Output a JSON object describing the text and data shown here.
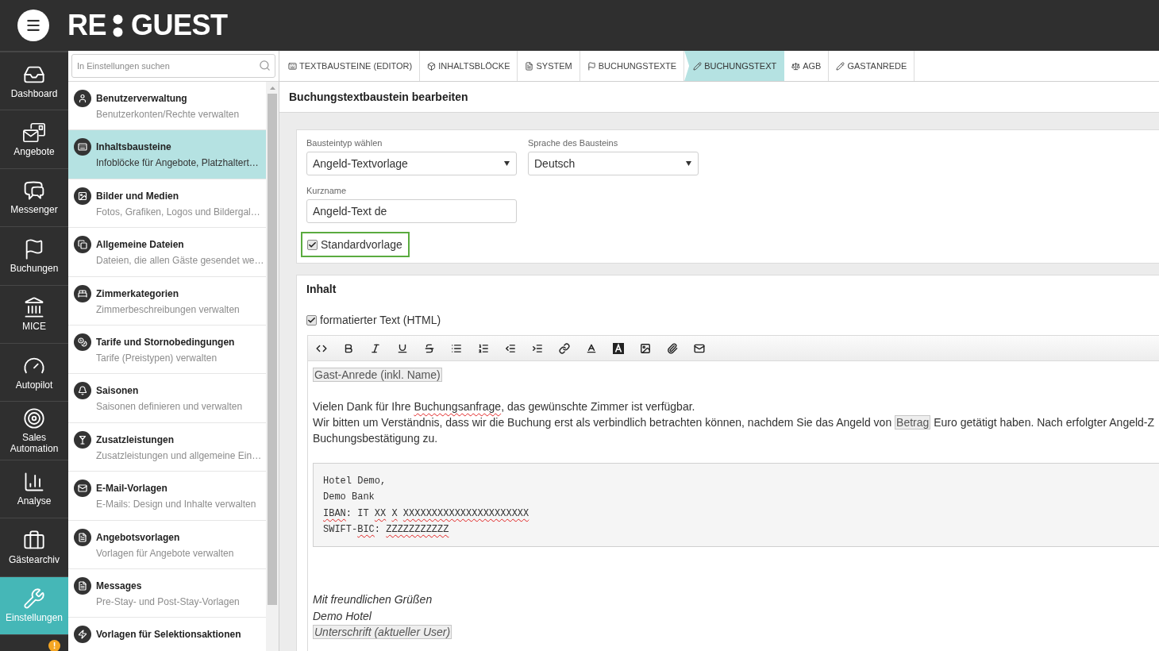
{
  "header": {
    "logo_left": "RE",
    "logo_right": "GUEST"
  },
  "nav": [
    {
      "label": "Dashboard",
      "selected": false
    },
    {
      "label": "Angebote",
      "selected": false
    },
    {
      "label": "Messenger",
      "selected": false
    },
    {
      "label": "Buchungen",
      "selected": false
    },
    {
      "label": "MICE",
      "selected": false
    },
    {
      "label": "Autopilot",
      "selected": false
    },
    {
      "label": "Sales Automation",
      "selected": false
    },
    {
      "label": "Analyse",
      "selected": false
    },
    {
      "label": "Gästearchiv",
      "selected": false
    },
    {
      "label": "Einstellungen",
      "selected": true
    },
    {
      "badge": "!",
      "selected": false
    }
  ],
  "settings": {
    "search": {
      "placeholder": "In Einstellungen suchen"
    },
    "items": [
      {
        "title": "Benutzerverwaltung",
        "subtitle": "Benutzerkonten/Rechte verwalten",
        "selected": false
      },
      {
        "title": "Inhaltsbausteine",
        "subtitle": "Infoblöcke für Angebote, Platzhaltert…",
        "selected": true
      },
      {
        "title": "Bilder und Medien",
        "subtitle": "Fotos, Grafiken, Logos und Bildergal…",
        "selected": false
      },
      {
        "title": "Allgemeine Dateien",
        "subtitle": "Dateien, die allen Gäste gesendet we…",
        "selected": false
      },
      {
        "title": "Zimmerkategorien",
        "subtitle": "Zimmerbeschreibungen verwalten",
        "selected": false
      },
      {
        "title": "Tarife und Stornobedingungen",
        "subtitle": "Tarife (Preistypen) verwalten",
        "selected": false
      },
      {
        "title": "Saisonen",
        "subtitle": "Saisonen definieren und verwalten",
        "selected": false
      },
      {
        "title": "Zusatzleistungen",
        "subtitle": "Zusatzleistungen und allgemeine Ein…",
        "selected": false
      },
      {
        "title": "E-Mail-Vorlagen",
        "subtitle": "E-Mails: Design und Inhalte verwalten",
        "selected": false
      },
      {
        "title": "Angebotsvorlagen",
        "subtitle": "Vorlagen für Angebote verwalten",
        "selected": false
      },
      {
        "title": "Messages",
        "subtitle": "Pre-Stay- und Post-Stay-Vorlagen",
        "selected": false
      },
      {
        "title": "Vorlagen für Selektionsaktionen",
        "selected": false
      }
    ]
  },
  "tabs": [
    {
      "label": "TEXTBAUSTEINE (EDITOR)",
      "selected": false
    },
    {
      "label": "INHALTSBLÖCKE",
      "selected": false
    },
    {
      "label": "SYSTEM",
      "selected": false
    },
    {
      "label": "BUCHUNGSTEXTE",
      "selected": false
    },
    {
      "label": "BUCHUNGSTEXT",
      "selected": true
    },
    {
      "label": "AGB",
      "selected": false
    },
    {
      "label": "GASTANREDE",
      "selected": false
    }
  ],
  "page_title": "Buchungstextbaustein bearbeiten",
  "form": {
    "type_select": {
      "label": "Bausteintyp wählen",
      "value": "Angeld-Textvorlage"
    },
    "language_select": {
      "label": "Sprache des Bausteins",
      "value": "Deutsch"
    },
    "short_name": {
      "label": "Kurzname",
      "value": "Angeld-Text de"
    },
    "default_template": {
      "label": "Standardvorlage",
      "checked": true,
      "focused": true
    }
  },
  "content": {
    "title": "Inhalt",
    "html_mode": {
      "label": "formatierter Text (HTML)",
      "checked": true
    },
    "blocks": [
      {
        "kind": "paragraph",
        "lines": [
          [
            {
              "kind": "placeholder",
              "text": "Gast-Anrede (inkl. Name)"
            }
          ]
        ]
      },
      {
        "kind": "paragraph",
        "lines": [
          [
            {
              "kind": "plain",
              "text": "Vielen Dank für Ihre "
            },
            {
              "kind": "misspelled",
              "text": "Buchungsanfrage"
            },
            {
              "kind": "plain",
              "text": ", das gewünschte Zimmer ist verfügbar."
            }
          ],
          [
            {
              "kind": "plain",
              "text": "Wir bitten um Verständnis, dass wir die Buchung erst als verbindlich betrachten können, nachdem Sie das Angeld von "
            },
            {
              "kind": "placeholder",
              "text": "Betrag"
            },
            {
              "kind": "plain",
              "text": " Euro getätigt haben. Nach erfolgter Angeld-Z"
            }
          ],
          [
            {
              "kind": "plain",
              "text": "Buchungsbestätigung zu."
            }
          ]
        ]
      },
      {
        "kind": "code",
        "lines": [
          [
            {
              "kind": "plain",
              "text": "Hotel Demo,"
            }
          ],
          [
            {
              "kind": "plain",
              "text": "Demo Bank"
            }
          ],
          [
            {
              "kind": "misspelled",
              "text": "IBAN"
            },
            {
              "kind": "plain",
              "text": ": IT "
            },
            {
              "kind": "misspelled",
              "text": "XX "
            },
            {
              "kind": "misspelled",
              "text": "X "
            },
            {
              "kind": "misspelled",
              "text": "XXXXXXXXXXXXXXXXXXXXXX"
            }
          ],
          [
            {
              "kind": "plain",
              "text": "SWIFT-"
            },
            {
              "kind": "misspelled",
              "text": "BIC"
            },
            {
              "kind": "plain",
              "text": ": "
            },
            {
              "kind": "misspelled",
              "text": "ZZZZZZZZZZZ"
            }
          ]
        ]
      },
      {
        "kind": "closing",
        "lines": [
          [
            {
              "kind": "plain",
              "text": "Mit freundlichen Grüßen"
            }
          ],
          [
            {
              "kind": "plain",
              "text": "Demo Hotel"
            }
          ],
          [
            {
              "kind": "placeholder",
              "text": "Unterschrift (aktueller User)"
            }
          ]
        ]
      }
    ]
  }
}
